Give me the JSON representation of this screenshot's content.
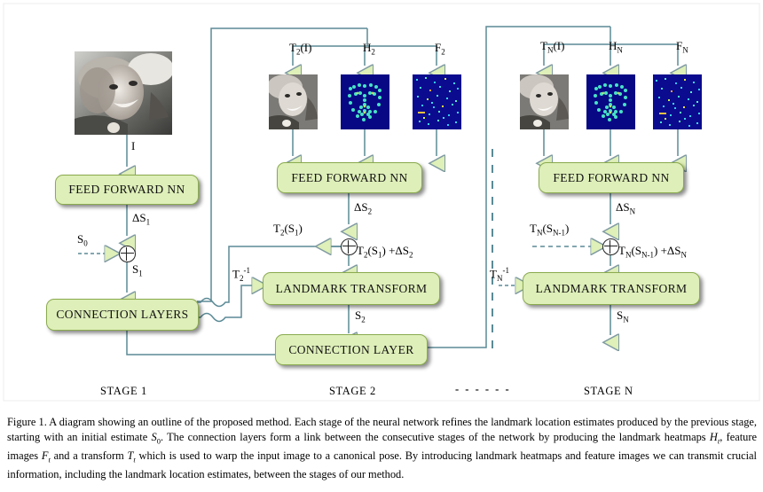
{
  "figure": {
    "stages": [
      {
        "name": "stage-1",
        "label": "STAGE 1"
      },
      {
        "name": "stage-2",
        "label": "STAGE 2"
      },
      {
        "name": "stage-separator",
        "label": "- - - - - -"
      },
      {
        "name": "stage-n",
        "label": "STAGE N"
      }
    ],
    "boxes": [
      {
        "name": "feed-forward-nn-stage1",
        "label": "FEED FORWARD NN"
      },
      {
        "name": "connection-layers-stage1",
        "label": "CONNECTION LAYERS"
      },
      {
        "name": "feed-forward-nn-stage2",
        "label": "FEED FORWARD NN"
      },
      {
        "name": "landmark-transform-stage2",
        "label": "LANDMARK TRANSFORM"
      },
      {
        "name": "connection-layer-stage2",
        "label": "CONNECTION LAYER"
      },
      {
        "name": "feed-forward-nn-stagen",
        "label": "FEED FORWARD NN"
      },
      {
        "name": "landmark-transform-stagen",
        "label": "LANDMARK TRANSFORM"
      }
    ],
    "stage1": {
      "input_image_label": "I",
      "delta_label": "ΔS",
      "delta_sub": "1",
      "initial_label": "S",
      "initial_sub": "0",
      "shape_label": "S",
      "shape_sub": "1"
    },
    "stage2": {
      "warped_image_label": "T",
      "warped_image_sub": "2",
      "warped_image_arg": "(I)",
      "heatmap_label": "H",
      "heatmap_sub": "2",
      "feature_label": "F",
      "feature_sub": "2",
      "delta_label": "ΔS",
      "delta_sub": "2",
      "transformed_shape": "T",
      "transformed_shape_sub": "2",
      "transformed_shape_arg": "(S",
      "transformed_shape_arg_sub": "1",
      "transformed_shape_arg_end": ")",
      "sum_label": "T",
      "sum_sub": "2",
      "sum_mid": "(S",
      "sum_mid_sub": "1",
      "sum_end": ") +ΔS",
      "sum_end_sub": "2",
      "inverse_label": "T",
      "inverse_sub": "2",
      "inverse_sup": "-1",
      "output_label": "S",
      "output_sub": "2"
    },
    "stageN": {
      "warped_image_label": "T",
      "warped_image_sub": "N",
      "warped_image_arg": "(I)",
      "heatmap_label": "H",
      "heatmap_sub": "N",
      "feature_label": "F",
      "feature_sub": "N",
      "delta_label": "ΔS",
      "delta_sub": "N",
      "transformed_shape": "T",
      "transformed_shape_sub": "N",
      "transformed_shape_arg": "(S",
      "transformed_shape_arg_sub": "N-1",
      "transformed_shape_arg_end": ")",
      "sum_label": "T",
      "sum_sub": "N",
      "sum_mid": "(S",
      "sum_mid_sub": "N-1",
      "sum_end": ") +ΔS",
      "sum_end_sub": "N",
      "inverse_label": "T",
      "inverse_sub": "N",
      "inverse_sup": "-1",
      "output_label": "S",
      "output_sub": "N"
    },
    "images": [
      {
        "name": "input-face-image",
        "kind": "grayscale-face-photo"
      },
      {
        "name": "warped-face-image-stage2",
        "kind": "grayscale-face-photo"
      },
      {
        "name": "landmark-heatmap-stage2",
        "kind": "landmark-heatmap"
      },
      {
        "name": "feature-image-stage2",
        "kind": "feature-noise-image"
      },
      {
        "name": "warped-face-image-stagen",
        "kind": "grayscale-face-photo"
      },
      {
        "name": "landmark-heatmap-stagen",
        "kind": "landmark-heatmap"
      },
      {
        "name": "feature-image-stagen",
        "kind": "feature-noise-image"
      }
    ],
    "colors": {
      "box_fill": "#deefb9",
      "box_border": "#8aab4e",
      "wire": "#5b8a96",
      "arrow_fill": "#dff0b8",
      "heatmap_bg": "#0a0a8c",
      "heatmap_dot": "#4fe6d8"
    }
  },
  "caption": {
    "prefix": "Figure 1.",
    "text_1": " A diagram showing an outline of the proposed method. Each stage of the neural network refines the landmark location estimates produced by the previous stage, starting with an initial estimate ",
    "sym_s0": "S",
    "sym_s0_sub": "0",
    "text_2": ". The connection layers form a link between the consecutive stages of the network by producing the landmark heatmaps ",
    "sym_ht": "H",
    "sym_ht_sub": "t",
    "text_3": ", feature images ",
    "sym_ft": "F",
    "sym_ft_sub": "t",
    "text_4": " and a transform ",
    "sym_tt": "T",
    "sym_tt_sub": "t",
    "text_5": " which is used to warp the input image to a canonical pose. By introducing landmark heatmaps and feature images we can transmit crucial information, including the landmark location estimates, between the stages of our method."
  }
}
